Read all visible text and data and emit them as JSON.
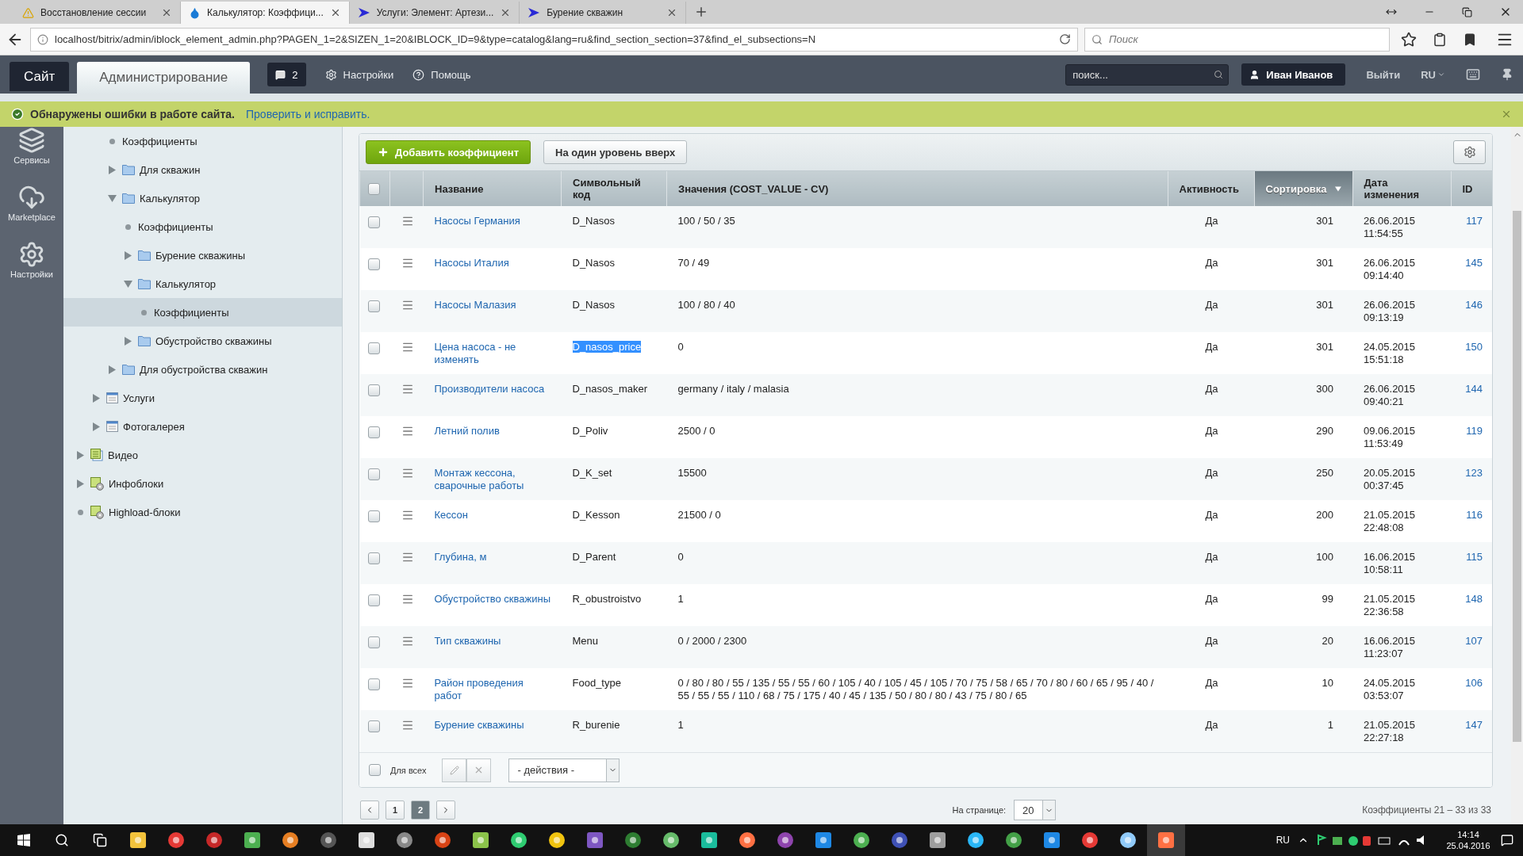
{
  "browser": {
    "tabs": [
      {
        "title": "Восстановление сессии",
        "kind": "warning",
        "selected": false
      },
      {
        "title": "Калькулятор: Коэффици...",
        "kind": "drop",
        "selected": true
      },
      {
        "title": "Услуги: Элемент: Артези...",
        "kind": "arrow",
        "selected": false
      },
      {
        "title": "Бурение скважин",
        "kind": "arrow",
        "selected": false
      }
    ],
    "url": "localhost/bitrix/admin/iblock_element_admin.php?PAGEN_1=2&SIZEN_1=20&IBLOCK_ID=9&type=catalog&lang=ru&find_section_section=37&find_el_subsections=N",
    "search_placeholder": "Поиск"
  },
  "admin_bar": {
    "tabs": [
      {
        "label": "Сайт",
        "selected": false
      },
      {
        "label": "Администрирование",
        "selected": true
      }
    ],
    "notifications": "2",
    "links": [
      {
        "label": "Настройки",
        "kind": "gear"
      },
      {
        "label": "Помощь",
        "kind": "help"
      }
    ],
    "search_placeholder": "поиск...",
    "user": "Иван Иванов",
    "logout": "Выйти",
    "language": "RU"
  },
  "alert": {
    "message": "Обнаружены ошибки в работе сайта.",
    "link": "Проверить и исправить."
  },
  "nav": [
    {
      "label": "Сервисы",
      "kind": "layers"
    },
    {
      "label": "Marketplace",
      "kind": "cloud"
    },
    {
      "label": "Настройки",
      "kind": "gear"
    }
  ],
  "tree": [
    {
      "children": [
        {
          "children": [
            {
              "label": "Коэффициенты",
              "selected": false
            },
            {
              "label": "Для скважин",
              "kind": "folder",
              "expanded": false,
              "selected": false
            },
            {
              "label": "Калькулятор",
              "kind": "folder",
              "expanded": true,
              "selected": false,
              "children": [
                {
                  "label": "Коэффициенты",
                  "selected": false
                },
                {
                  "label": "Бурение скважины",
                  "kind": "folder",
                  "expanded": false,
                  "selected": false
                },
                {
                  "label": "Калькулятор",
                  "kind": "folder",
                  "expanded": true,
                  "selected": false,
                  "children": [
                    {
                      "label": "Коэффициенты",
                      "selected": true
                    }
                  ]
                },
                {
                  "label": "Обустройство скважины",
                  "kind": "folder",
                  "expanded": false,
                  "selected": false
                }
              ]
            },
            {
              "label": "Для обустройства скважин",
              "kind": "folder",
              "expanded": false,
              "selected": false
            }
          ]
        },
        {
          "label": "Услуги",
          "kind": "list",
          "expanded": false,
          "selected": false
        },
        {
          "label": "Фотогалерея",
          "kind": "list",
          "expanded": false,
          "selected": false
        }
      ]
    },
    {
      "label": "Видео",
      "kind": "doc",
      "expanded": false,
      "selected": false
    },
    {
      "label": "Инфоблоки",
      "kind": "gear-doc",
      "expanded": false,
      "selected": false
    },
    {
      "label": "Highload-блоки",
      "kind": "gear-doc",
      "selected": false
    }
  ],
  "toolbar": {
    "add": "Добавить коэффициент",
    "up": "На один уровень вверх"
  },
  "table": {
    "all_checked": false,
    "columns": [
      {
        "label": "Название",
        "sorted": false
      },
      {
        "label": "Символьный код",
        "sorted": false
      },
      {
        "label": "Значения (COST_VALUE - CV)",
        "sorted": false
      },
      {
        "label": "Активность",
        "sorted": false
      },
      {
        "label": "Сортировка",
        "sorted": true
      },
      {
        "label": "Дата изменения",
        "sorted": false
      },
      {
        "label": "ID",
        "sorted": false
      }
    ],
    "rows": [
      {
        "name": "Насосы Германия",
        "code": "D_Nasos",
        "code_highlighted": false,
        "values": "100 / 50 / 35",
        "active": "Да",
        "sort": "301",
        "modified": "26.06.2015 11:54:55",
        "id": "117",
        "checked": false
      },
      {
        "name": "Насосы Италия",
        "code": "D_Nasos",
        "code_highlighted": false,
        "values": "70 / 49",
        "active": "Да",
        "sort": "301",
        "modified": "26.06.2015 09:14:40",
        "id": "145",
        "checked": false
      },
      {
        "name": "Насосы Малазия",
        "code": "D_Nasos",
        "code_highlighted": false,
        "values": "100 / 80 / 40",
        "active": "Да",
        "sort": "301",
        "modified": "26.06.2015 09:13:19",
        "id": "146",
        "checked": false
      },
      {
        "name": "Цена насоса - не изменять",
        "code": "D_nasos_price",
        "code_highlighted": true,
        "values": "0",
        "active": "Да",
        "sort": "301",
        "modified": "24.05.2015 15:51:18",
        "id": "150",
        "checked": false
      },
      {
        "name": "Производители насоса",
        "code": "D_nasos_maker",
        "code_highlighted": false,
        "values": "germany / italy / malasia",
        "active": "Да",
        "sort": "300",
        "modified": "26.06.2015 09:40:21",
        "id": "144",
        "checked": false
      },
      {
        "name": "Летний полив",
        "code": "D_Poliv",
        "code_highlighted": false,
        "values": "2500 / 0",
        "active": "Да",
        "sort": "290",
        "modified": "09.06.2015 11:53:49",
        "id": "119",
        "checked": false
      },
      {
        "name": "Монтаж кессона, сварочные работы",
        "code": "D_K_set",
        "code_highlighted": false,
        "values": "15500",
        "active": "Да",
        "sort": "250",
        "modified": "20.05.2015 00:37:45",
        "id": "123",
        "checked": false
      },
      {
        "name": "Кессон",
        "code": "D_Kesson",
        "code_highlighted": false,
        "values": "21500 / 0",
        "active": "Да",
        "sort": "200",
        "modified": "21.05.2015 22:48:08",
        "id": "116",
        "checked": false
      },
      {
        "name": "Глубина, м",
        "code": "D_Parent",
        "code_highlighted": false,
        "values": "0",
        "active": "Да",
        "sort": "100",
        "modified": "16.06.2015 10:58:11",
        "id": "115",
        "checked": false
      },
      {
        "name": "Обустройство скважины",
        "code": "R_obustroistvo",
        "code_highlighted": false,
        "values": "1",
        "active": "Да",
        "sort": "99",
        "modified": "21.05.2015 22:36:58",
        "id": "148",
        "checked": false
      },
      {
        "name": "Тип скважины",
        "code": "Menu",
        "code_highlighted": false,
        "values": "0 / 2000 / 2300",
        "active": "Да",
        "sort": "20",
        "modified": "16.06.2015 11:23:07",
        "id": "107",
        "checked": false
      },
      {
        "name": "Район проведения работ",
        "code": "Food_type",
        "code_highlighted": false,
        "values": "0 / 80 / 80 / 55 / 135 / 55 / 55 / 60 / 105 / 40 / 105 / 45 / 105 / 70 / 75 / 58 / 65 / 70 / 80 / 60 / 65 / 95 / 40 / 55 / 55 / 55 / 110 / 68 / 75 / 175 / 40 / 45 / 135 / 50 / 80 / 80 / 43 / 75 / 80 / 65",
        "active": "Да",
        "sort": "10",
        "modified": "24.05.2015 03:53:07",
        "id": "106",
        "checked": false
      },
      {
        "name": "Бурение скважины",
        "code": "R_burenie",
        "code_highlighted": false,
        "values": "1",
        "active": "Да",
        "sort": "1",
        "modified": "21.05.2015 22:27:18",
        "id": "147",
        "checked": false
      }
    ]
  },
  "footer": {
    "all_label": "Для всех",
    "all_checked": false,
    "action": "- действия -"
  },
  "pagination": {
    "pages": [
      {
        "label": "1",
        "selected": false
      },
      {
        "label": "2",
        "selected": true
      }
    ],
    "per_page_label": "На странице:",
    "per_page": "20",
    "summary": "Коэффициенты 21 – 33 из 33"
  },
  "taskbar": {
    "language": "RU",
    "time": "14:14",
    "date": "25.04.2016"
  }
}
